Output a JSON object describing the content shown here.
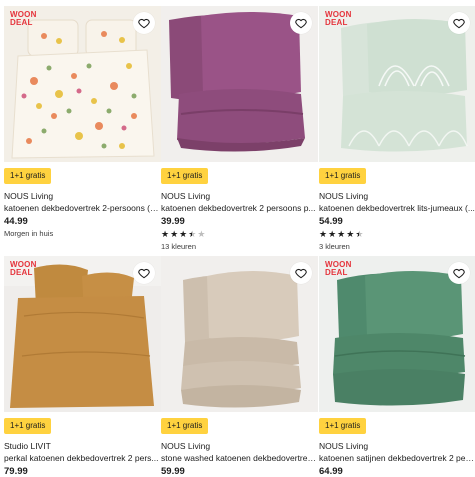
{
  "products": [
    {
      "badge": "WOON DEAL",
      "promo": "1+1 gratis",
      "brand": "NOUS Living",
      "title": "katoenen dekbedovertrek 2-persoons (2...",
      "price": "44.99",
      "note": "Morgen in huis",
      "icon": "heart-outline-icon"
    },
    {
      "badge": "",
      "promo": "1+1 gratis",
      "brand": "NOUS Living",
      "title": "katoenen dekbedovertrek 2 persoons p...",
      "price": "39.99",
      "rating": 3.5,
      "colors": "13 kleuren",
      "icon": "heart-outline-icon"
    },
    {
      "badge": "WOON DEAL",
      "promo": "1+1 gratis",
      "brand": "NOUS Living",
      "title": "katoenen dekbedovertrek lits-jumeaux (...",
      "price": "54.99",
      "rating": 4.5,
      "colors": "3 kleuren",
      "icon": "heart-outline-icon"
    },
    {
      "badge": "WOON DEAL",
      "promo": "1+1 gratis",
      "brand": "Studio LIVIT",
      "title": "perkal katoenen dekbedovertrek 2 pers...",
      "price": "79.99",
      "icon": "heart-outline-icon"
    },
    {
      "badge": "",
      "promo": "1+1 gratis",
      "brand": "NOUS Living",
      "title": "stone washed katoenen dekbedovertrek...",
      "price": "59.99",
      "icon": "heart-outline-icon"
    },
    {
      "badge": "WOON DEAL",
      "promo": "1+1 gratis",
      "brand": "NOUS Living",
      "title": "katoenen satijnen dekbedovertrek 2 pers...",
      "price": "64.99",
      "icon": "heart-outline-icon"
    }
  ]
}
